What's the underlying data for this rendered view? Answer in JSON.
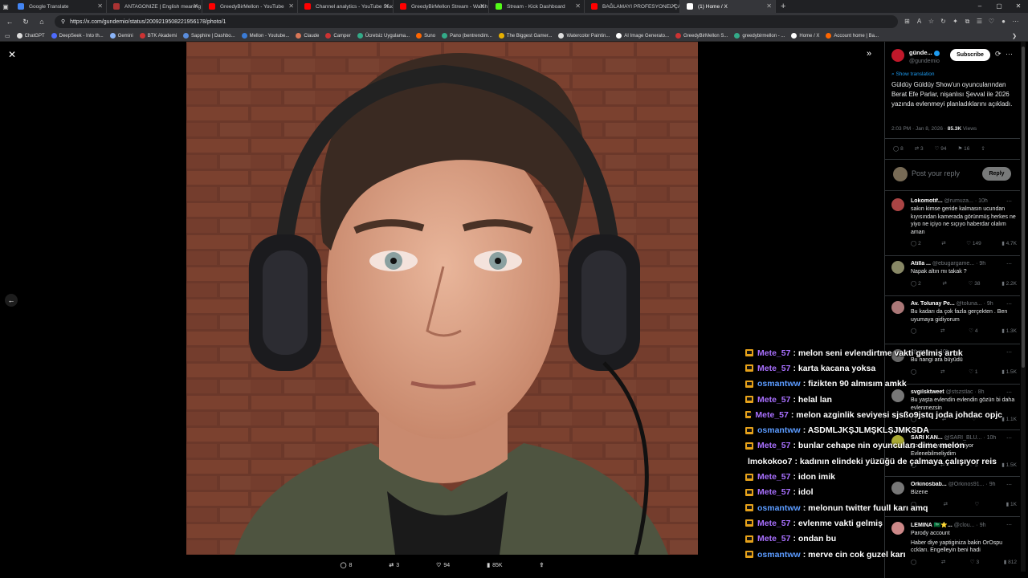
{
  "tabs": [
    {
      "title": "Google Translate",
      "color": "#4285f4",
      "active": false
    },
    {
      "title": "ANTAGONIZE | English meaning -",
      "color": "#a33",
      "active": false
    },
    {
      "title": "GreedyBirMellon - YouTube",
      "color": "#f00",
      "active": false
    },
    {
      "title": "Channel analytics - YouTube Studi",
      "color": "#f00",
      "active": false
    },
    {
      "title": "GreedyBirMellon Stream - Watch",
      "color": "#f00",
      "active": false
    },
    {
      "title": "Stream - Kick Dashboard",
      "color": "#53fc18",
      "active": false
    },
    {
      "title": "BAĞLAMAYI PROFESYONEL ÇALM",
      "color": "#f00",
      "active": false
    },
    {
      "title": "(1) Home / X",
      "color": "#fff",
      "active": true
    }
  ],
  "url": "https://x.com/gundemio/status/2009219508221956178/photo/1",
  "bookmarks": [
    {
      "label": "ChatGPT",
      "color": "#ddd"
    },
    {
      "label": "DeepSeek - Into th...",
      "color": "#4d6bfe"
    },
    {
      "label": "Gemini",
      "color": "#8ab4f8"
    },
    {
      "label": "BTK Akademi",
      "color": "#c33"
    },
    {
      "label": "Sapphire | Dashbo...",
      "color": "#5a8ddc"
    },
    {
      "label": "Mellon - Youtube...",
      "color": "#3a7bd5"
    },
    {
      "label": "Claude",
      "color": "#d97757"
    },
    {
      "label": "Camper",
      "color": "#c33"
    },
    {
      "label": "Ücretsiz Uygulama...",
      "color": "#3a8"
    },
    {
      "label": "Suno",
      "color": "#f60"
    },
    {
      "label": "Pano (bentrendim...",
      "color": "#3a8"
    },
    {
      "label": "The Biggest Gamer...",
      "color": "#e8b000"
    },
    {
      "label": "Watercolor Paintin...",
      "color": "#ddd"
    },
    {
      "label": "AI Image Generato...",
      "color": "#fff"
    },
    {
      "label": "GreedyBirMellon S...",
      "color": "#c33"
    },
    {
      "label": "greedybirmellon - ...",
      "color": "#3a8"
    },
    {
      "label": "Home / X",
      "color": "#fff"
    },
    {
      "label": "Account home | Ba...",
      "color": "#f60"
    }
  ],
  "post": {
    "name": "günde...",
    "handle": "@gundemio",
    "subscribe": "Subscribe",
    "show_translation": "Show translation",
    "text": "Güldüy Güldüy Show'un oyuncularından Berat Efe Parlar, nişanlısı Şevval ile 2026 yazında evlenmeyi planladıklarını açıkladı.",
    "time": "2:03 PM · Jan 8, 2026 ·",
    "views_num": "85.3K",
    "views_label": "Views",
    "replies": "8",
    "reposts": "3",
    "likes": "94",
    "bookmarks": "16",
    "reply_placeholder": "Post your reply",
    "reply_button": "Reply"
  },
  "bottom_stats": {
    "replies": "8",
    "reposts": "3",
    "likes": "94",
    "views": "85K"
  },
  "replies": [
    {
      "name": "Lokomotif...",
      "handle": "@rumuza...",
      "time": "· 10h",
      "text": "sakın kimse geride kalmasın ucundan kıyısından kamerada görünmüş herkes ne yiyo ne içiyo ne sıçıyo haberdar olalım aman",
      "r": "2",
      "rt": "",
      "l": "149",
      "v": "4.7K",
      "av": "#a44"
    },
    {
      "name": "Atilla ...",
      "handle": "@ebugargame...",
      "time": "· 9h",
      "text": "Napak altın mı takak ?",
      "r": "2",
      "rt": "",
      "l": "38",
      "v": "2.2K",
      "av": "#886"
    },
    {
      "name": "Av. Tolunay Pe...",
      "handle": "@toluna...",
      "time": "· 9h",
      "text": "Bu kadarı da çok fazla gerçekten . Ben uyumaya gidiyorum",
      "r": "",
      "rt": "",
      "l": "4",
      "v": "1.3K",
      "av": "#a77"
    },
    {
      "name": "",
      "handle": "@yapm...",
      "time": "· 10h",
      "text": "Bu hangi ara büyüdü",
      "r": "",
      "rt": "",
      "l": "1",
      "v": "1.5K",
      "av": "#666"
    },
    {
      "name": "svgilsktweet",
      "handle": "@stszstlac",
      "time": "· 8h",
      "text": "Bu yaşta evlendin evlendin gözün bi daha evlenmezsin",
      "r": "",
      "rt": "",
      "l": "",
      "v": "1.1K",
      "av": "#777"
    },
    {
      "name": "SARI KAN...",
      "handle": "@SARI_BLU...",
      "time": "· 10h",
      "text": "Çocuk bu yaşta evleniyor Evlenebilmeliydim",
      "r": "",
      "rt": "",
      "l": "5",
      "v": "1.5K",
      "av": "#aa3"
    },
    {
      "name": "Orkinosbab...",
      "handle": "@Orkinos91...",
      "time": "· 9h",
      "text": "Bizene",
      "r": "",
      "rt": "",
      "l": "",
      "v": "1K",
      "av": "#777"
    },
    {
      "name": "LEMINA 🇸🇦⭐...",
      "handle": "@clou...",
      "time": "· 9h",
      "text": "Parody account",
      "text2": "Haber diye yaptiginiza bakin OrOspu cckları. Engelleyin beni hadi",
      "r": "",
      "rt": "",
      "l": "3",
      "v": "812",
      "av": "#c88"
    }
  ],
  "chat": [
    {
      "user": "Mete_57",
      "color": "#a970ff",
      "msg": ": melon seni evlendirtme vakti gelmiş artık",
      "crown": true
    },
    {
      "user": "Mete_57",
      "color": "#a970ff",
      "msg": ": karta kacana yoksa",
      "crown": true
    },
    {
      "user": "osmantww",
      "color": "#5b9bff",
      "msg": ": fizikten 90 almısım amkk",
      "crown": true
    },
    {
      "user": "Mete_57",
      "color": "#a970ff",
      "msg": ": helal lan",
      "crown": true
    },
    {
      "user": "Mete_57",
      "color": "#a970ff",
      "msg": ": melon azginlik seviyesi sjsßo9jstq joda johdac opjc",
      "crown": true
    },
    {
      "user": "osmantww",
      "color": "#5b9bff",
      "msg": ": ASDMLJKŞJLMŞKLŞJMKSDA",
      "crown": true
    },
    {
      "user": "Mete_57",
      "color": "#a970ff",
      "msg": ": bunlar cehape nin oyuncuları dime melon",
      "crown": true
    },
    {
      "user": "lmokokoo7",
      "color": "#ffffff",
      "msg": ": kadının elindeki yüzüğü de çalmaya çalışıyor reis",
      "crown": false
    },
    {
      "user": "Mete_57",
      "color": "#a970ff",
      "msg": ": idon imik",
      "crown": true
    },
    {
      "user": "Mete_57",
      "color": "#a970ff",
      "msg": ": idol",
      "crown": true
    },
    {
      "user": "osmantww",
      "color": "#5b9bff",
      "msg": ": melonun twitter fuull karı amq",
      "crown": true
    },
    {
      "user": "Mete_57",
      "color": "#a970ff",
      "msg": ": evlenme vakti gelmiş",
      "crown": true
    },
    {
      "user": "Mete_57",
      "color": "#a970ff",
      "msg": ": ondan bu",
      "crown": true
    },
    {
      "user": "osmantww",
      "color": "#5b9bff",
      "msg": ": merve cin cok guzel karı",
      "crown": true
    }
  ]
}
